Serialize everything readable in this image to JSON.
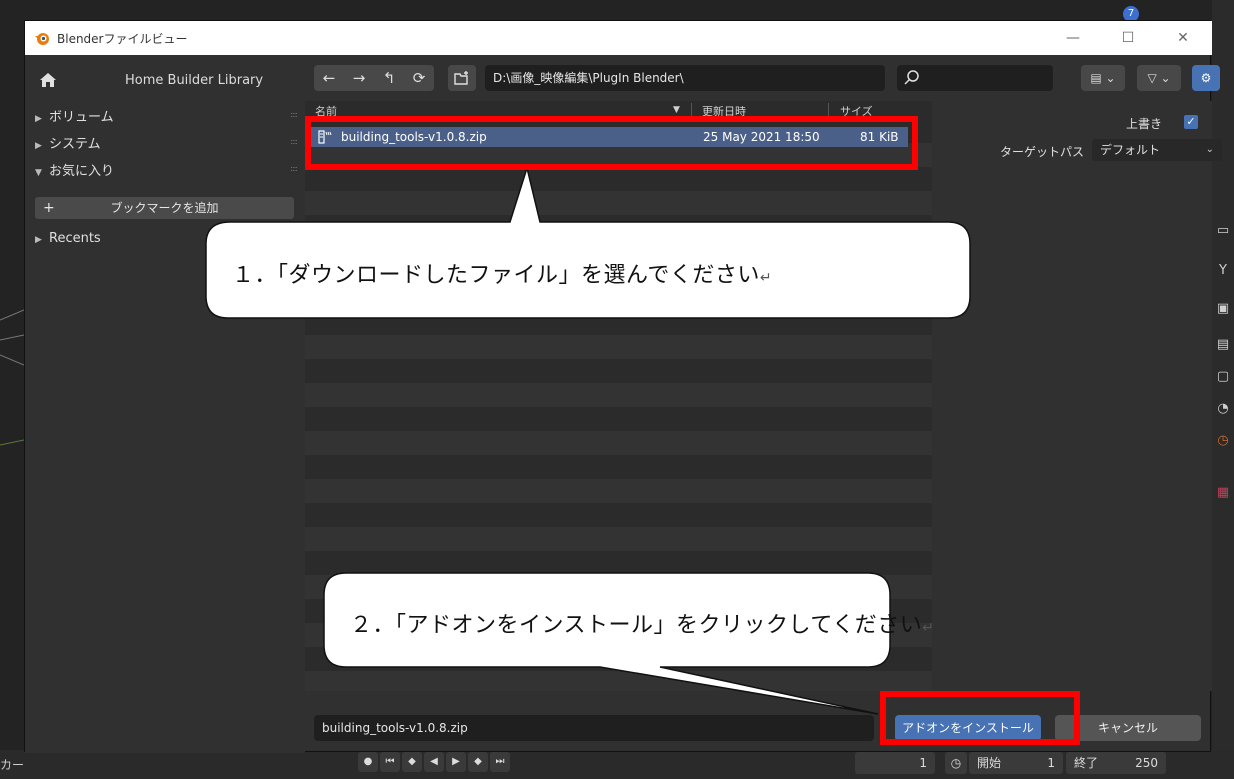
{
  "window": {
    "title": "Blenderファイルビュー",
    "minimize": "—",
    "maximize": "☐",
    "close": "✕"
  },
  "sidebar": {
    "home_label": "Home Builder Library",
    "items": [
      {
        "label": "ボリューム",
        "expanded": false
      },
      {
        "label": "システム",
        "expanded": false
      },
      {
        "label": "お気に入り",
        "expanded": true
      }
    ],
    "add_bookmark": "ブックマークを追加",
    "recents_label": "Recents"
  },
  "toolbar": {
    "back": "←",
    "forward": "→",
    "parent": "↰",
    "refresh": "⟳",
    "new_dir": "🗀",
    "path": "D:\\画像_映像編集\\PlugIn Blender\\",
    "search_placeholder": "",
    "display_mode": "▤ ⌄",
    "filter": "▽ ⌄",
    "settings": "⚙"
  },
  "file_list": {
    "columns": [
      "名前",
      "更新日時",
      "サイズ"
    ],
    "sort_indicator": "▼",
    "rows": [
      {
        "name": "building_tools-v1.0.8.zip",
        "date": "25 May 2021 18:50",
        "size": "81 KiB",
        "selected": true
      }
    ]
  },
  "options": {
    "overwrite_label": "上書き",
    "overwrite_checked": true,
    "target_path_label": "ターゲットパス",
    "target_path_value": "デフォルト"
  },
  "bottom": {
    "filename": "building_tools-v1.0.8.zip",
    "install_button": "アドオンをインストール",
    "cancel_button": "キャンセル"
  },
  "background": {
    "left_label": "カー",
    "frame_current": "1",
    "start_label": "開始",
    "start_value": "1",
    "end_label": "終了",
    "end_value": "250",
    "badge": "7"
  },
  "annotations": {
    "callout1": "１．「ダウンロードしたファイル」を選んでください",
    "callout2": "２．「アドオンをインストール」をクリックしてください",
    "return_mark": "↵"
  },
  "colors": {
    "accent": "#4772b3",
    "selection": "#4a6089",
    "highlight_box": "#ff0000"
  }
}
